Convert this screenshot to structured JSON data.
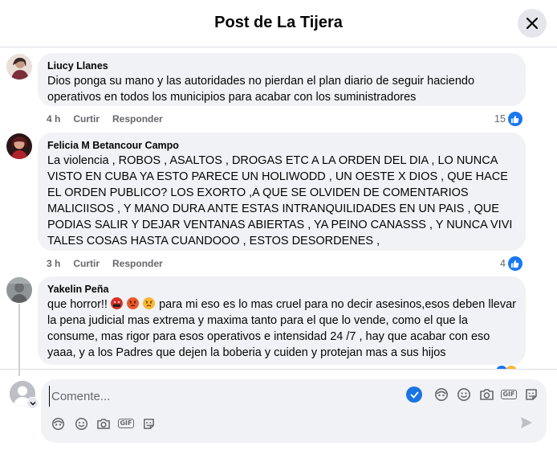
{
  "header": {
    "title": "Post de La Tijera"
  },
  "comments": [
    {
      "author": "Liucy Llanes",
      "text": "Dios ponga su mano y las autoridades no pierdan el plan diario de seguir haciendo operativos en todos los municipios para acabar con los suministradores",
      "time": "4 h",
      "like_label": "Curtir",
      "reply_label": "Responder",
      "reaction_count": "15"
    },
    {
      "author": "Felicia M Betancour Campo",
      "text": "La violencia , ROBOS , ASALTOS , DROGAS ETC A LA ORDEN DEL DIA , LO NUNCA VISTO EN CUBA YA ESTO PARECE UN HOLIWODD , UN OESTE X DIOS , QUE HACE EL ORDEN PUBLICO? LOS EXORTO ,A QUE SE OLVIDEN DE COMENTARIOS MALICIISOS , Y MANO DURA ANTE ESTAS INTRANQUILIDADES EN UN PAIS , QUE PODIAS SALIR Y DEJAR VENTANAS ABIERTAS , YA PEINO CANASSS , Y NUNCA VIVI TALES COSAS HASTA CUANDOOO , ESTOS DESORDENES ,",
      "time": "3 h",
      "like_label": "Curtir",
      "reply_label": "Responder",
      "reaction_count": "4"
    },
    {
      "author": "Yakelin Peña",
      "text_start": "que horror!!",
      "emojis": [
        "cursing-face-emoji",
        "angry-face-emoji",
        "angry-face-emoji"
      ],
      "text_rest": " para mi eso es lo mas cruel para no decir asesinos,esos deben llevar la pena judicial mas extrema y maxima tanto para el que lo vende, como el que la consume, mas rigor para esos operativos e intensidad 24 /7 , hay que acabar con eso yaaa, y a los Padres que dejen la boberia y cuiden y protejan mas a sus hijos"
    }
  ],
  "composer": {
    "placeholder": "Comente..."
  },
  "colors": {
    "accent": "#1877f2",
    "bubble": "#f0f2f5",
    "meta": "#65676b"
  }
}
